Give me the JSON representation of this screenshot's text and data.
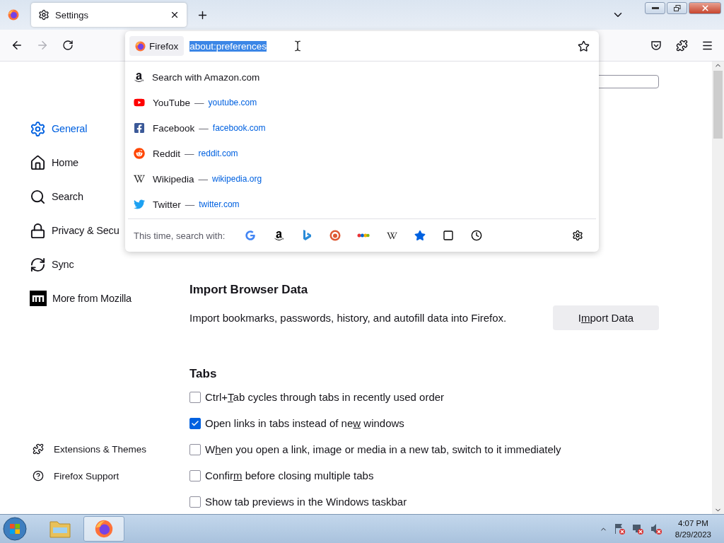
{
  "tabs": [
    {
      "title": "Settings",
      "selected": true
    }
  ],
  "urlbar": {
    "identity": "Firefox",
    "value": "about:preferences"
  },
  "suggestions": [
    {
      "kind": "search",
      "title": "Search with Amazon.com"
    },
    {
      "kind": "site",
      "title": "YouTube",
      "separator": "—",
      "url": "youtube.com"
    },
    {
      "kind": "site",
      "title": "Facebook",
      "separator": "—",
      "url": "facebook.com"
    },
    {
      "kind": "site",
      "title": "Reddit",
      "separator": "—",
      "url": "reddit.com"
    },
    {
      "kind": "site",
      "title": "Wikipedia",
      "separator": "—",
      "url": "wikipedia.org"
    },
    {
      "kind": "site",
      "title": "Twitter",
      "separator": "—",
      "url": "twitter.com"
    }
  ],
  "search_with": {
    "label": "This time, search with:"
  },
  "sidebar": {
    "items": [
      {
        "label": "General",
        "selected": true
      },
      {
        "label": "Home",
        "selected": false
      },
      {
        "label": "Search",
        "selected": false
      },
      {
        "label": "Privacy & Secu",
        "selected": false
      },
      {
        "label": "Sync",
        "selected": false
      },
      {
        "label": "More from Mozilla",
        "selected": false
      }
    ],
    "footer_links": [
      "Extensions & Themes",
      "Firefox Support"
    ]
  },
  "import_section": {
    "heading": "Import Browser Data",
    "text": "Import bookmarks, passwords, history, and autofill data into Firefox.",
    "button": [
      "I",
      "m",
      "port Data"
    ]
  },
  "tabs_section": {
    "heading": "Tabs",
    "options": [
      {
        "label": [
          "Ctrl+",
          "T",
          "ab cycles through tabs in recently used order"
        ],
        "checked": false
      },
      {
        "label": [
          "Open links in tabs instead of ne",
          "w",
          " windows"
        ],
        "checked": true
      },
      {
        "label": [
          "W",
          "h",
          "en you open a link, image or media in a new tab, switch to it immediately"
        ],
        "checked": false
      },
      {
        "label": [
          "Confir",
          "m",
          " before closing multiple tabs"
        ],
        "checked": false
      },
      {
        "label": [
          "Show tab previews in the Windows taskbar"
        ],
        "checked": false
      }
    ]
  },
  "taskbar": {
    "time": "4:07 PM",
    "date": "8/29/2023"
  }
}
